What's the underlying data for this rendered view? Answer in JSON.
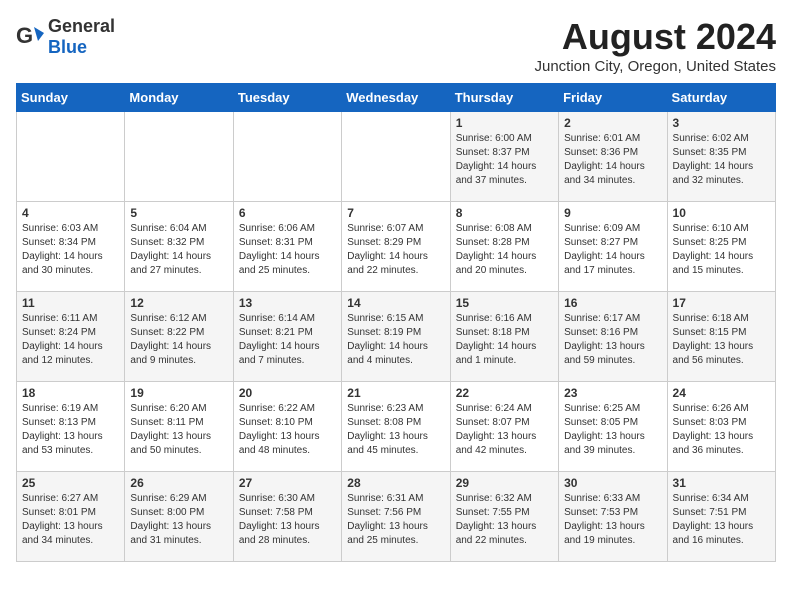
{
  "header": {
    "logo_general": "General",
    "logo_blue": "Blue",
    "month_year": "August 2024",
    "location": "Junction City, Oregon, United States"
  },
  "days_of_week": [
    "Sunday",
    "Monday",
    "Tuesday",
    "Wednesday",
    "Thursday",
    "Friday",
    "Saturday"
  ],
  "weeks": [
    [
      {
        "day": "",
        "info": ""
      },
      {
        "day": "",
        "info": ""
      },
      {
        "day": "",
        "info": ""
      },
      {
        "day": "",
        "info": ""
      },
      {
        "day": "1",
        "info": "Sunrise: 6:00 AM\nSunset: 8:37 PM\nDaylight: 14 hours\nand 37 minutes."
      },
      {
        "day": "2",
        "info": "Sunrise: 6:01 AM\nSunset: 8:36 PM\nDaylight: 14 hours\nand 34 minutes."
      },
      {
        "day": "3",
        "info": "Sunrise: 6:02 AM\nSunset: 8:35 PM\nDaylight: 14 hours\nand 32 minutes."
      }
    ],
    [
      {
        "day": "4",
        "info": "Sunrise: 6:03 AM\nSunset: 8:34 PM\nDaylight: 14 hours\nand 30 minutes."
      },
      {
        "day": "5",
        "info": "Sunrise: 6:04 AM\nSunset: 8:32 PM\nDaylight: 14 hours\nand 27 minutes."
      },
      {
        "day": "6",
        "info": "Sunrise: 6:06 AM\nSunset: 8:31 PM\nDaylight: 14 hours\nand 25 minutes."
      },
      {
        "day": "7",
        "info": "Sunrise: 6:07 AM\nSunset: 8:29 PM\nDaylight: 14 hours\nand 22 minutes."
      },
      {
        "day": "8",
        "info": "Sunrise: 6:08 AM\nSunset: 8:28 PM\nDaylight: 14 hours\nand 20 minutes."
      },
      {
        "day": "9",
        "info": "Sunrise: 6:09 AM\nSunset: 8:27 PM\nDaylight: 14 hours\nand 17 minutes."
      },
      {
        "day": "10",
        "info": "Sunrise: 6:10 AM\nSunset: 8:25 PM\nDaylight: 14 hours\nand 15 minutes."
      }
    ],
    [
      {
        "day": "11",
        "info": "Sunrise: 6:11 AM\nSunset: 8:24 PM\nDaylight: 14 hours\nand 12 minutes."
      },
      {
        "day": "12",
        "info": "Sunrise: 6:12 AM\nSunset: 8:22 PM\nDaylight: 14 hours\nand 9 minutes."
      },
      {
        "day": "13",
        "info": "Sunrise: 6:14 AM\nSunset: 8:21 PM\nDaylight: 14 hours\nand 7 minutes."
      },
      {
        "day": "14",
        "info": "Sunrise: 6:15 AM\nSunset: 8:19 PM\nDaylight: 14 hours\nand 4 minutes."
      },
      {
        "day": "15",
        "info": "Sunrise: 6:16 AM\nSunset: 8:18 PM\nDaylight: 14 hours\nand 1 minute."
      },
      {
        "day": "16",
        "info": "Sunrise: 6:17 AM\nSunset: 8:16 PM\nDaylight: 13 hours\nand 59 minutes."
      },
      {
        "day": "17",
        "info": "Sunrise: 6:18 AM\nSunset: 8:15 PM\nDaylight: 13 hours\nand 56 minutes."
      }
    ],
    [
      {
        "day": "18",
        "info": "Sunrise: 6:19 AM\nSunset: 8:13 PM\nDaylight: 13 hours\nand 53 minutes."
      },
      {
        "day": "19",
        "info": "Sunrise: 6:20 AM\nSunset: 8:11 PM\nDaylight: 13 hours\nand 50 minutes."
      },
      {
        "day": "20",
        "info": "Sunrise: 6:22 AM\nSunset: 8:10 PM\nDaylight: 13 hours\nand 48 minutes."
      },
      {
        "day": "21",
        "info": "Sunrise: 6:23 AM\nSunset: 8:08 PM\nDaylight: 13 hours\nand 45 minutes."
      },
      {
        "day": "22",
        "info": "Sunrise: 6:24 AM\nSunset: 8:07 PM\nDaylight: 13 hours\nand 42 minutes."
      },
      {
        "day": "23",
        "info": "Sunrise: 6:25 AM\nSunset: 8:05 PM\nDaylight: 13 hours\nand 39 minutes."
      },
      {
        "day": "24",
        "info": "Sunrise: 6:26 AM\nSunset: 8:03 PM\nDaylight: 13 hours\nand 36 minutes."
      }
    ],
    [
      {
        "day": "25",
        "info": "Sunrise: 6:27 AM\nSunset: 8:01 PM\nDaylight: 13 hours\nand 34 minutes."
      },
      {
        "day": "26",
        "info": "Sunrise: 6:29 AM\nSunset: 8:00 PM\nDaylight: 13 hours\nand 31 minutes."
      },
      {
        "day": "27",
        "info": "Sunrise: 6:30 AM\nSunset: 7:58 PM\nDaylight: 13 hours\nand 28 minutes."
      },
      {
        "day": "28",
        "info": "Sunrise: 6:31 AM\nSunset: 7:56 PM\nDaylight: 13 hours\nand 25 minutes."
      },
      {
        "day": "29",
        "info": "Sunrise: 6:32 AM\nSunset: 7:55 PM\nDaylight: 13 hours\nand 22 minutes."
      },
      {
        "day": "30",
        "info": "Sunrise: 6:33 AM\nSunset: 7:53 PM\nDaylight: 13 hours\nand 19 minutes."
      },
      {
        "day": "31",
        "info": "Sunrise: 6:34 AM\nSunset: 7:51 PM\nDaylight: 13 hours\nand 16 minutes."
      }
    ]
  ]
}
